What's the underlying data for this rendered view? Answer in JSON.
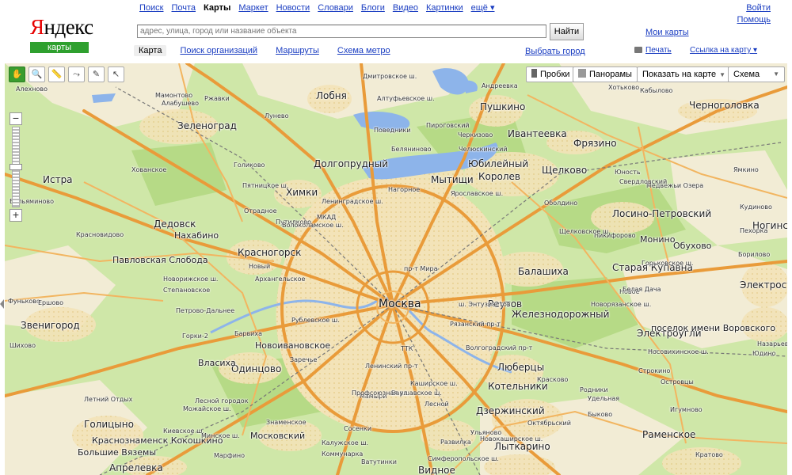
{
  "logo": {
    "text_red": "Я",
    "text_black": "ндекс",
    "sub": "карты"
  },
  "topnav": {
    "items": [
      {
        "label": "Поиск",
        "current": false
      },
      {
        "label": "Почта",
        "current": false
      },
      {
        "label": "Карты",
        "current": true
      },
      {
        "label": "Маркет",
        "current": false
      },
      {
        "label": "Новости",
        "current": false
      },
      {
        "label": "Словари",
        "current": false
      },
      {
        "label": "Блоги",
        "current": false
      },
      {
        "label": "Видео",
        "current": false
      },
      {
        "label": "Картинки",
        "current": false
      }
    ],
    "more": "ещё ▾"
  },
  "auth": {
    "login": "Войти",
    "help": "Помощь"
  },
  "search": {
    "value": "",
    "placeholder": "адрес, улица, город или название объекта",
    "button": "Найти"
  },
  "my_maps": "Мои карты",
  "subnav": {
    "items": [
      {
        "label": "Карта",
        "current": true
      },
      {
        "label": "Поиск организаций",
        "current": false
      },
      {
        "label": "Маршруты",
        "current": false
      },
      {
        "label": "Схема метро",
        "current": false
      }
    ]
  },
  "choose_city": "Выбрать город",
  "print": "Печать",
  "share": "Ссылка на карту ▾",
  "map_tools": [
    {
      "name": "drag-hand-icon",
      "glyph": "✋",
      "active": true
    },
    {
      "name": "zoom-area-icon",
      "glyph": "🔍",
      "active": false
    },
    {
      "name": "ruler-icon",
      "glyph": "📏",
      "active": false
    },
    {
      "name": "route-icon",
      "glyph": "⤳",
      "active": false
    },
    {
      "name": "balloon-icon",
      "glyph": "✎",
      "active": false
    },
    {
      "name": "pointer-icon",
      "glyph": "↖",
      "active": false
    }
  ],
  "zoom": {
    "plus": "+",
    "minus": "−"
  },
  "map_buttons": {
    "traffic": "Пробки",
    "panoramas": "Панорамы",
    "show_on_map": "Показать на карте",
    "layer": "Схема"
  },
  "colors": {
    "accent_green": "#3a9d2f",
    "link": "#1a3dc1",
    "logo_red": "#e60000",
    "road": "#f0a747",
    "water": "#7aa8e6",
    "forest": "#c9e4a3"
  },
  "map_labels": {
    "moscow": "Москва",
    "big": [
      "Зеленоград",
      "Лобня",
      "Пушкино",
      "Черноголовка",
      "Ивантеевка",
      "Фрязино",
      "Долгопрудный",
      "Юбилейный",
      "Щелково",
      "Мытищи",
      "Королев",
      "Химки",
      "Истра",
      "Дедовск",
      "Лосино-Петровский",
      "Красногорск",
      "Балашиха",
      "Старая Купавна",
      "Реутов",
      "Электросталь",
      "Звенигород",
      "Железнодорожный",
      "Одинцово",
      "Люберцы",
      "Котельники",
      "Электроугли",
      "Дзержинский",
      "Голицыно",
      "Лыткарино",
      "Видное",
      "Раменское",
      "Апрелевка",
      "Ногинск"
    ],
    "mid": [
      "Нахабино",
      "Павловская Слобода",
      "Новоивановское",
      "Московский",
      "Краснознаменск Кокошкино",
      "Большие Вяземы",
      "Монино",
      "Обухово",
      "поселок имени Воровского",
      "Власиха"
    ],
    "small": [
      "Алехново",
      "Ржавки",
      "Алабушево",
      "Луневo",
      "Хованское",
      "Поведники",
      "Пироговский",
      "Черкизово",
      "Беляниново",
      "Чeлюскинский",
      "Андреевка",
      "Голиково",
      "Нагорное",
      "Отрадное",
      "Путилково",
      "Вельяминово",
      "Красновидово",
      "Новый",
      "Архангельское",
      "Степановское",
      "Петрово-Дальнее",
      "Горки-2",
      "Барвиха",
      "Заречье",
      "Фуньково",
      "Ершово",
      "Шихово",
      "Назарьево",
      "Юдино",
      "Летний Отдых",
      "Лесной городок",
      "Марфино",
      "Мамонтово",
      "Хотьково",
      "Кабылово",
      "Медвежьи Озера",
      "Юность",
      "Свердловский",
      "Никифорово",
      "Новое",
      "Бориловo",
      "Пехорка",
      "Кудиново",
      "Ямкино",
      "Оболдино",
      "Белая Дача",
      "Строкино",
      "Островцы",
      "Родники",
      "Удельная",
      "Быково",
      "Игумново",
      "Октябрьский",
      "Красково",
      "Коммунарка",
      "Развилка",
      "Мамыри",
      "Сосенки",
      "Ватутинки",
      "Лесной",
      "Знаменское",
      "Ульяново",
      "Кратово"
    ]
  },
  "road_labels": [
    "МКАД",
    "ТТК",
    "Ленинградское ш.",
    "Дмитровское ш.",
    "Ярославское ш.",
    "Щелковское ш.",
    "ш. Энтузиастов",
    "Рязанский пр-т",
    "Волгоградский пр-т",
    "Каширское ш.",
    "Варшавское ш.",
    "Профсоюзная ул.",
    "Ленинский пр-т",
    "Можайское ш.",
    "Рублевское ш.",
    "Волоколамское ш.",
    "Пятницкое ш.",
    "Новорязанское ш.",
    "Калужское ш.",
    "Киевское ш.",
    "Минское ш.",
    "Симферопольское ш.",
    "Новокаширское ш.",
    "Горьковское ш.",
    "Носовихинское ш.",
    "Алтуфьевское ш.",
    "Новорижское ш.",
    "пр-т Мира"
  ]
}
